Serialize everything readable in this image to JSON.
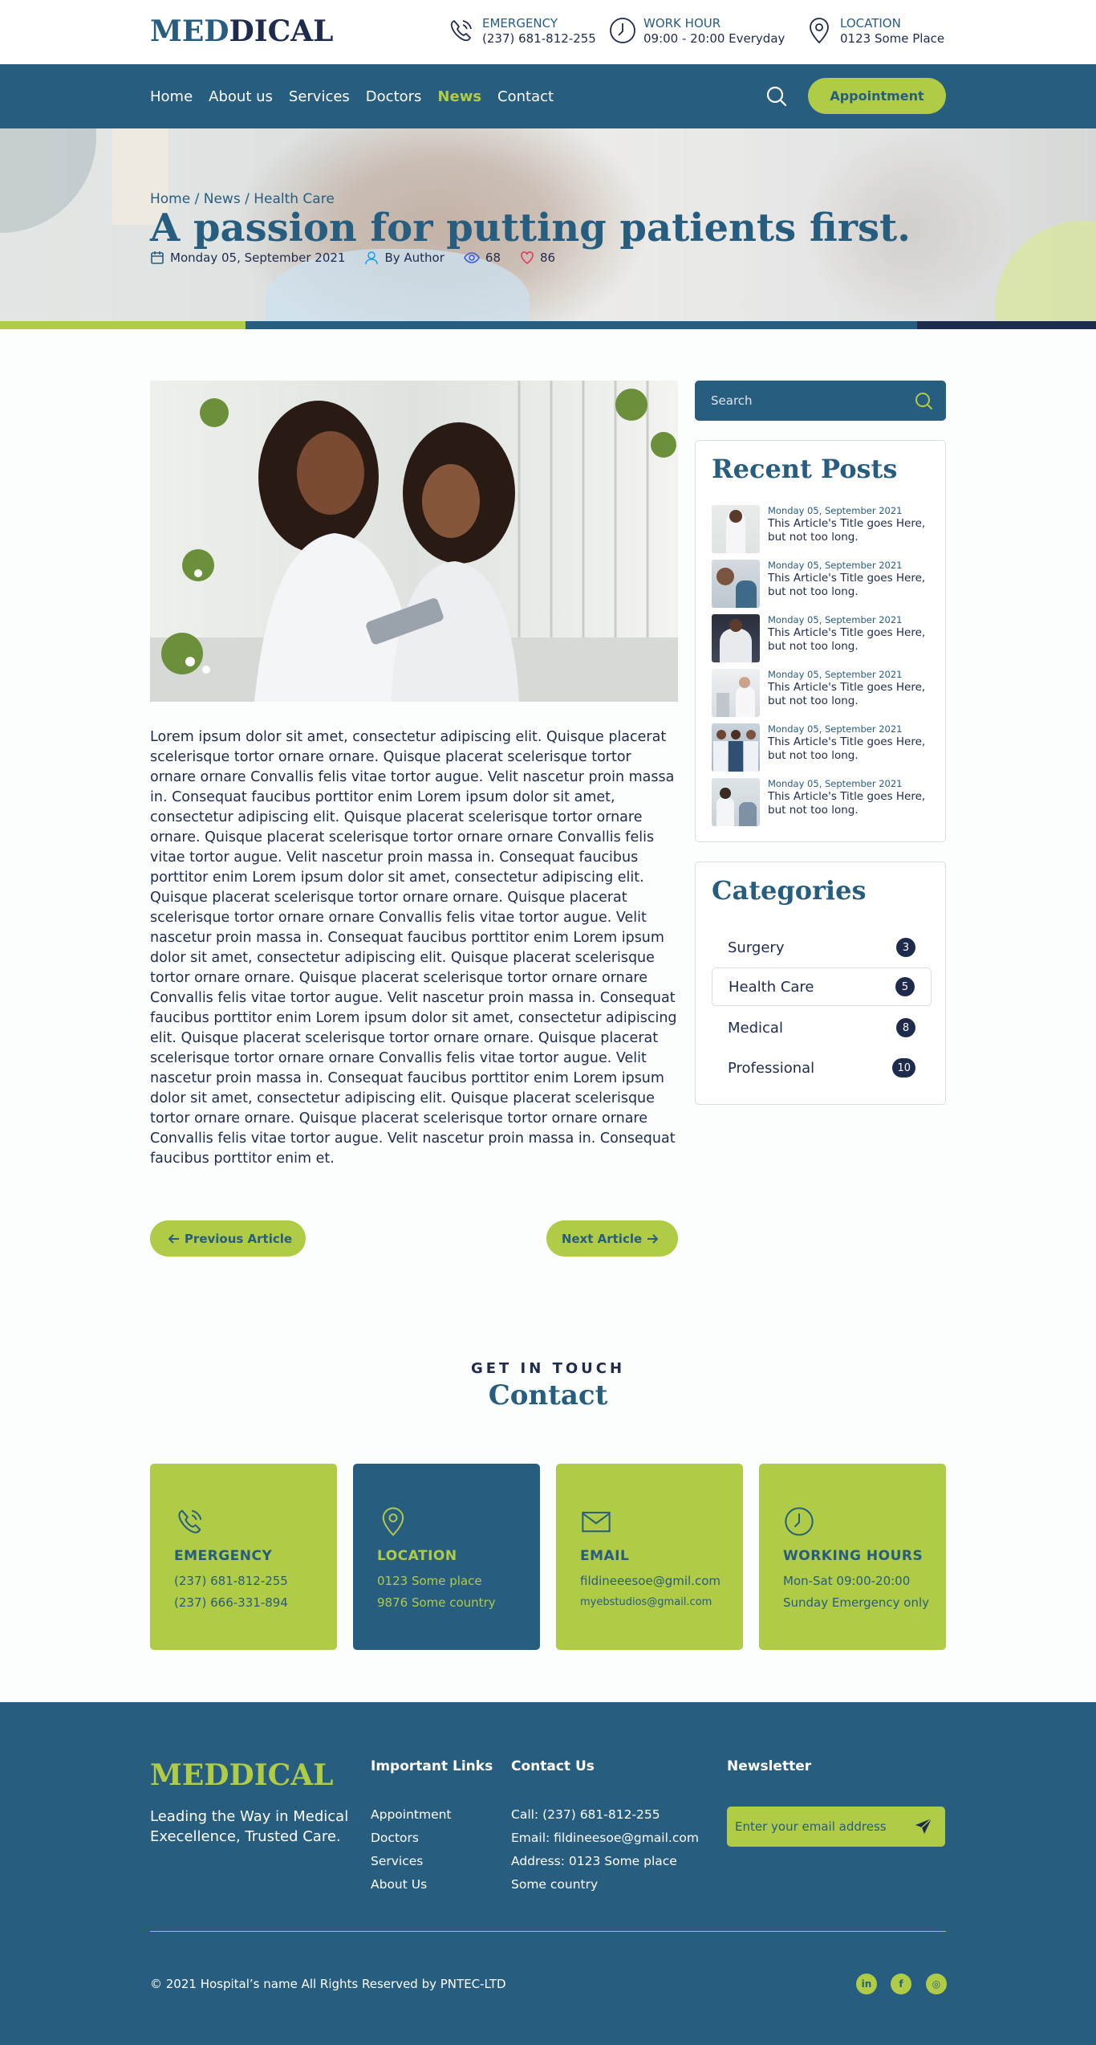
{
  "brand": {
    "logo_part1": "MED",
    "logo_part2": "DICAL",
    "footer_logo": "MEDDICAL"
  },
  "topinfo": [
    {
      "label": "EMERGENCY",
      "value": "(237) 681-812-255"
    },
    {
      "label": "WORK HOUR",
      "value": "09:00 - 20:00 Everyday"
    },
    {
      "label": "LOCATION",
      "value": "0123 Some Place"
    }
  ],
  "nav": {
    "items": [
      "Home",
      "About us",
      "Services",
      "Doctors",
      "News",
      "Contact"
    ],
    "active": "News",
    "appointment_label": "Appointment"
  },
  "hero": {
    "breadcrumb": "Home / News / Health Care",
    "title": "A passion for putting patients first.",
    "date": "Monday 05, September 2021",
    "author": "By Author",
    "views": "68",
    "likes": "86"
  },
  "article": {
    "body": "Lorem ipsum dolor sit amet, consectetur adipiscing elit. Quisque placerat scelerisque tortor ornare ornare. Quisque placerat scelerisque tortor ornare ornare Convallis felis vitae tortor augue. Velit nascetur proin massa in. Consequat faucibus porttitor enim Lorem ipsum dolor sit amet, consectetur adipiscing elit. Quisque placerat scelerisque tortor ornare ornare. Quisque placerat scelerisque tortor ornare ornare Convallis felis vitae tortor augue. Velit nascetur proin massa in. Consequat faucibus porttitor enim Lorem ipsum dolor sit amet, consectetur adipiscing elit. Quisque placerat scelerisque tortor ornare ornare. Quisque placerat scelerisque tortor ornare ornare Convallis felis vitae tortor augue. Velit nascetur proin massa in. Consequat faucibus porttitor enim Lorem ipsum dolor sit amet, consectetur adipiscing elit. Quisque placerat scelerisque tortor ornare ornare. Quisque placerat scelerisque tortor ornare ornare Convallis felis vitae tortor augue. Velit nascetur proin massa in. Consequat faucibus porttitor enim Lorem ipsum dolor sit amet, consectetur adipiscing elit. Quisque placerat scelerisque tortor ornare ornare. Quisque placerat scelerisque tortor ornare ornare Convallis felis vitae tortor augue. Velit nascetur proin massa in. Consequat faucibus porttitor enim Lorem ipsum dolor sit amet, consectetur adipiscing elit. Quisque placerat scelerisque tortor ornare ornare. Quisque placerat scelerisque tortor ornare ornare Convallis felis vitae tortor augue. Velit nascetur proin massa in. Consequat faucibus porttitor enim et.",
    "prev_label": "Previous Article",
    "next_label": "Next Article"
  },
  "sidebar": {
    "search_placeholder": "Search",
    "recent_title": "Recent Posts",
    "posts": [
      {
        "date": "Monday 05, September 2021",
        "title": "This Article's Title goes Here, but not too long."
      },
      {
        "date": "Monday 05, September 2021",
        "title": "This Article's Title goes Here, but not too long."
      },
      {
        "date": "Monday 05, September 2021",
        "title": "This Article's Title goes Here, but not too long."
      },
      {
        "date": "Monday 05, September 2021",
        "title": "This Article's Title goes Here, but not too long."
      },
      {
        "date": "Monday 05, September 2021",
        "title": "This Article's Title goes Here, but not too long."
      },
      {
        "date": "Monday 05, September 2021",
        "title": "This Article's Title goes Here, but not too long."
      }
    ],
    "categories_title": "Categories",
    "categories": [
      {
        "name": "Surgery",
        "count": "3"
      },
      {
        "name": "Health Care",
        "count": "5"
      },
      {
        "name": "Medical",
        "count": "8"
      },
      {
        "name": "Professional",
        "count": "10"
      }
    ],
    "selected_category": "Health Care"
  },
  "contact": {
    "eyebrow": "GET IN TOUCH",
    "title": "Contact",
    "cards": [
      {
        "icon": "phone-icon",
        "title": "EMERGENCY",
        "lines": [
          "(237) 681-812-255",
          "(237) 666-331-894"
        ]
      },
      {
        "icon": "location-icon",
        "title": "LOCATION",
        "lines": [
          "0123 Some place",
          "9876 Some country"
        ]
      },
      {
        "icon": "mail-icon",
        "title": "EMAIL",
        "lines": [
          "fildineeesoe@gmil.com",
          "myebstudios@gmail.com"
        ]
      },
      {
        "icon": "clock-icon",
        "title": "WORKING HOURS",
        "lines": [
          "Mon-Sat 09:00-20:00",
          "Sunday Emergency only"
        ]
      }
    ]
  },
  "footer": {
    "tagline": "Leading the Way in Medical Execellence, Trusted Care.",
    "links_title": "Important Links",
    "links": [
      "Appointment",
      "Doctors",
      "Services",
      "About Us"
    ],
    "contact_title": "Contact Us",
    "contact_lines": [
      "Call: (237) 681-812-255",
      "Email: fildineesoe@gmail.com",
      "Address: 0123 Some place",
      "Some country"
    ],
    "newsletter_title": "Newsletter",
    "newsletter_placeholder": "Enter your email address",
    "copyright": "© 2021 Hospital’s name All Rights Reserved by PNTEC-LTD",
    "social": [
      {
        "icon": "linkedin-icon",
        "glyph": "in"
      },
      {
        "icon": "facebook-icon",
        "glyph": "f"
      },
      {
        "icon": "instagram-icon",
        "glyph": "◎"
      }
    ]
  },
  "colors": {
    "primary": "#275d7e",
    "accent": "#b0cb46",
    "dark": "#1f2b4c",
    "white": "#ffffff"
  }
}
